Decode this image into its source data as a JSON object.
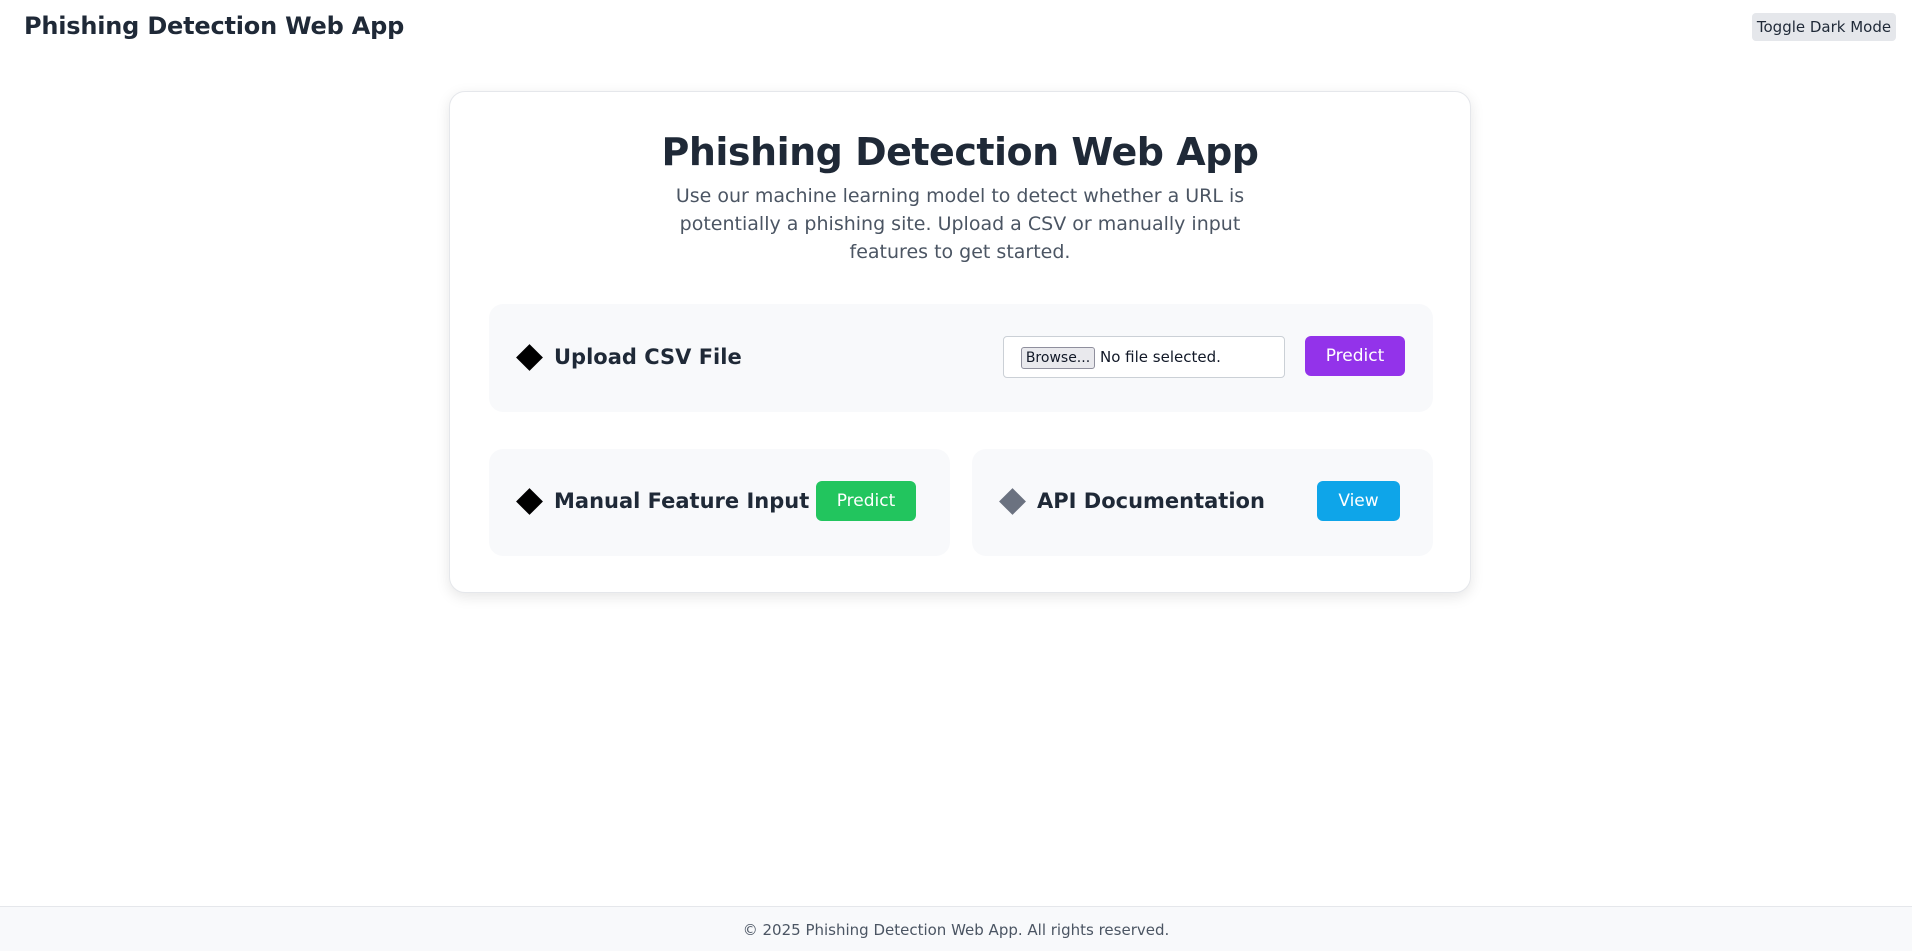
{
  "header": {
    "title": "Phishing Detection Web App",
    "toggle_label": "Toggle Dark Mode"
  },
  "hero": {
    "title": "Phishing Detection Web App",
    "description": "Use our machine learning model to detect whether a URL is potentially a phishing site. Upload a CSV or manually input features to get started."
  },
  "upload": {
    "icon": "diamond-icon",
    "label": "Upload CSV File",
    "browse_label": "Browse...",
    "file_status": "No file selected.",
    "predict_label": "Predict"
  },
  "manual": {
    "icon": "diamond-icon",
    "label": "Manual Feature Input",
    "predict_label": "Predict"
  },
  "api": {
    "icon": "diamond-icon",
    "label": "API Documentation",
    "view_label": "View"
  },
  "footer": {
    "text": "© 2025 Phishing Detection Web App. All rights reserved."
  },
  "colors": {
    "purple_button": "#9333ea",
    "green_button": "#22c55e",
    "blue_button": "#0ea5e9",
    "panel_background": "#f8f9fb",
    "text_primary": "#1f2937",
    "text_secondary": "#4b5563"
  }
}
